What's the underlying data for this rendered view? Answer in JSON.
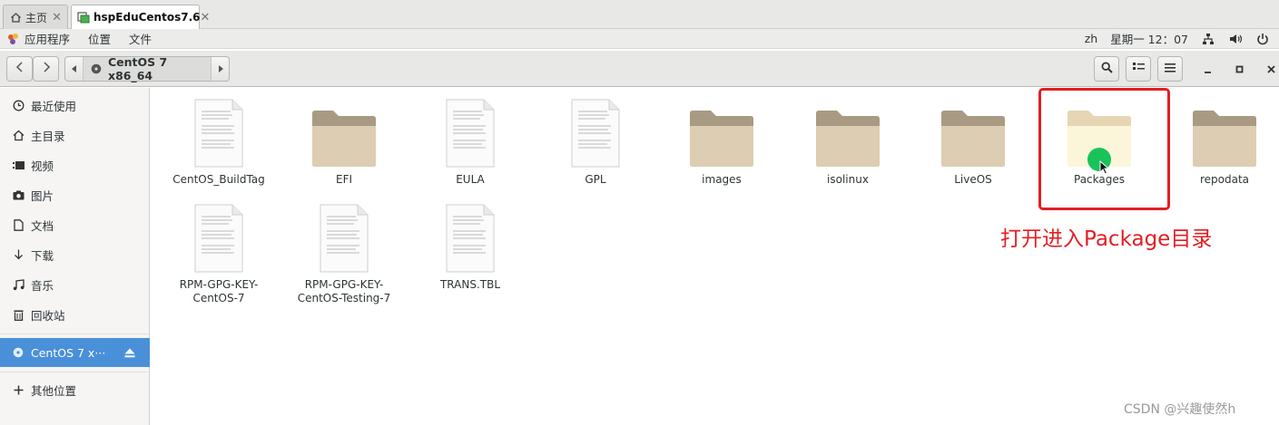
{
  "tabs": [
    {
      "label": "主页",
      "icon": "home-icon"
    },
    {
      "label": "hspEduCentos7.6",
      "icon": "vm-icon"
    }
  ],
  "panel": {
    "menus": [
      "应用程序",
      "位置",
      "文件"
    ],
    "lang": "zh",
    "clock": "星期一 12：07"
  },
  "location": {
    "current": "CentOS 7 x86_64"
  },
  "sidebar": {
    "items": [
      {
        "label": "最近使用",
        "icon": "clock-icon"
      },
      {
        "label": "主目录",
        "icon": "home-icon"
      },
      {
        "label": "视频",
        "icon": "video-icon"
      },
      {
        "label": "图片",
        "icon": "camera-icon"
      },
      {
        "label": "文档",
        "icon": "document-icon"
      },
      {
        "label": "下载",
        "icon": "download-icon"
      },
      {
        "label": "音乐",
        "icon": "music-icon"
      },
      {
        "label": "回收站",
        "icon": "trash-icon"
      }
    ],
    "device": {
      "label": "CentOS 7 x···",
      "icon": "disc-icon"
    },
    "other": {
      "label": "其他位置",
      "icon": "plus-icon"
    }
  },
  "files": [
    {
      "name": "CentOS_BuildTag",
      "kind": "file"
    },
    {
      "name": "EFI",
      "kind": "folder"
    },
    {
      "name": "EULA",
      "kind": "file"
    },
    {
      "name": "GPL",
      "kind": "file"
    },
    {
      "name": "images",
      "kind": "folder"
    },
    {
      "name": "isolinux",
      "kind": "folder"
    },
    {
      "name": "LiveOS",
      "kind": "folder"
    },
    {
      "name": "Packages",
      "kind": "folder"
    },
    {
      "name": "repodata",
      "kind": "folder"
    },
    {
      "name": "RPM-GPG-KEY-\nCentOS-7",
      "kind": "file"
    },
    {
      "name": "RPM-GPG-KEY-\nCentOS-Testing-7",
      "kind": "file"
    },
    {
      "name": "TRANS.TBL",
      "kind": "file"
    }
  ],
  "annotation": "打开进入Package目录",
  "watermark": "CSDN @兴趣使然h",
  "colors": {
    "accent": "#4a90d9",
    "annotation": "#e31e24",
    "folder": "#d9c9ab",
    "cursor_dot": "#19c35a"
  }
}
